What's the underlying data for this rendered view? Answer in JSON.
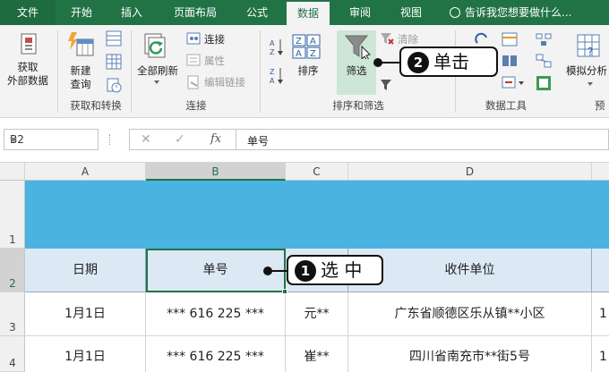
{
  "tabs": [
    "文件",
    "开始",
    "插入",
    "页面布局",
    "公式",
    "数据",
    "审阅",
    "视图"
  ],
  "tell_me": "告诉我您想要做什么...",
  "ribbon": {
    "get_external_line1": "获取",
    "get_external_line2": "外部数据",
    "new_query_line1": "新建",
    "new_query_line2": "查询",
    "refresh_all": "全部刷新",
    "connections": "连接",
    "properties": "属性",
    "edit_links": "编辑链接",
    "sort": "排序",
    "filter": "筛选",
    "clear": "清除",
    "what_if": "模拟分析",
    "groups": {
      "get_transform": "获取和转换",
      "connections": "连接",
      "sort_filter": "排序和筛选",
      "data_tools": "数据工具",
      "forecast": "预"
    }
  },
  "callouts": {
    "step1_num": "1",
    "step1_text": "选 中",
    "step2_num": "2",
    "step2_text": "单击"
  },
  "formula_bar": {
    "name_box": "B2",
    "cancel": "✕",
    "enter": "✓",
    "fx": "fx",
    "content": "单号"
  },
  "columns": [
    "A",
    "B",
    "C",
    "D"
  ],
  "rows": [
    "1",
    "2",
    "3",
    "4"
  ],
  "table": {
    "header": [
      "日期",
      "单号",
      "",
      "收件单位"
    ],
    "row3": [
      "1月1日",
      "*** 616 225 ***",
      "元**",
      "广东省顺德区乐从镇**小区"
    ],
    "row4": [
      "1月1日",
      "*** 616 225 ***",
      "崔**",
      "四川省南充市**街5号"
    ],
    "partial_e": [
      "1",
      "1"
    ]
  },
  "colors": {
    "ribbon_green": "#217346",
    "banner_blue": "#4ab3e2",
    "header_fill": "#dce9f5"
  }
}
